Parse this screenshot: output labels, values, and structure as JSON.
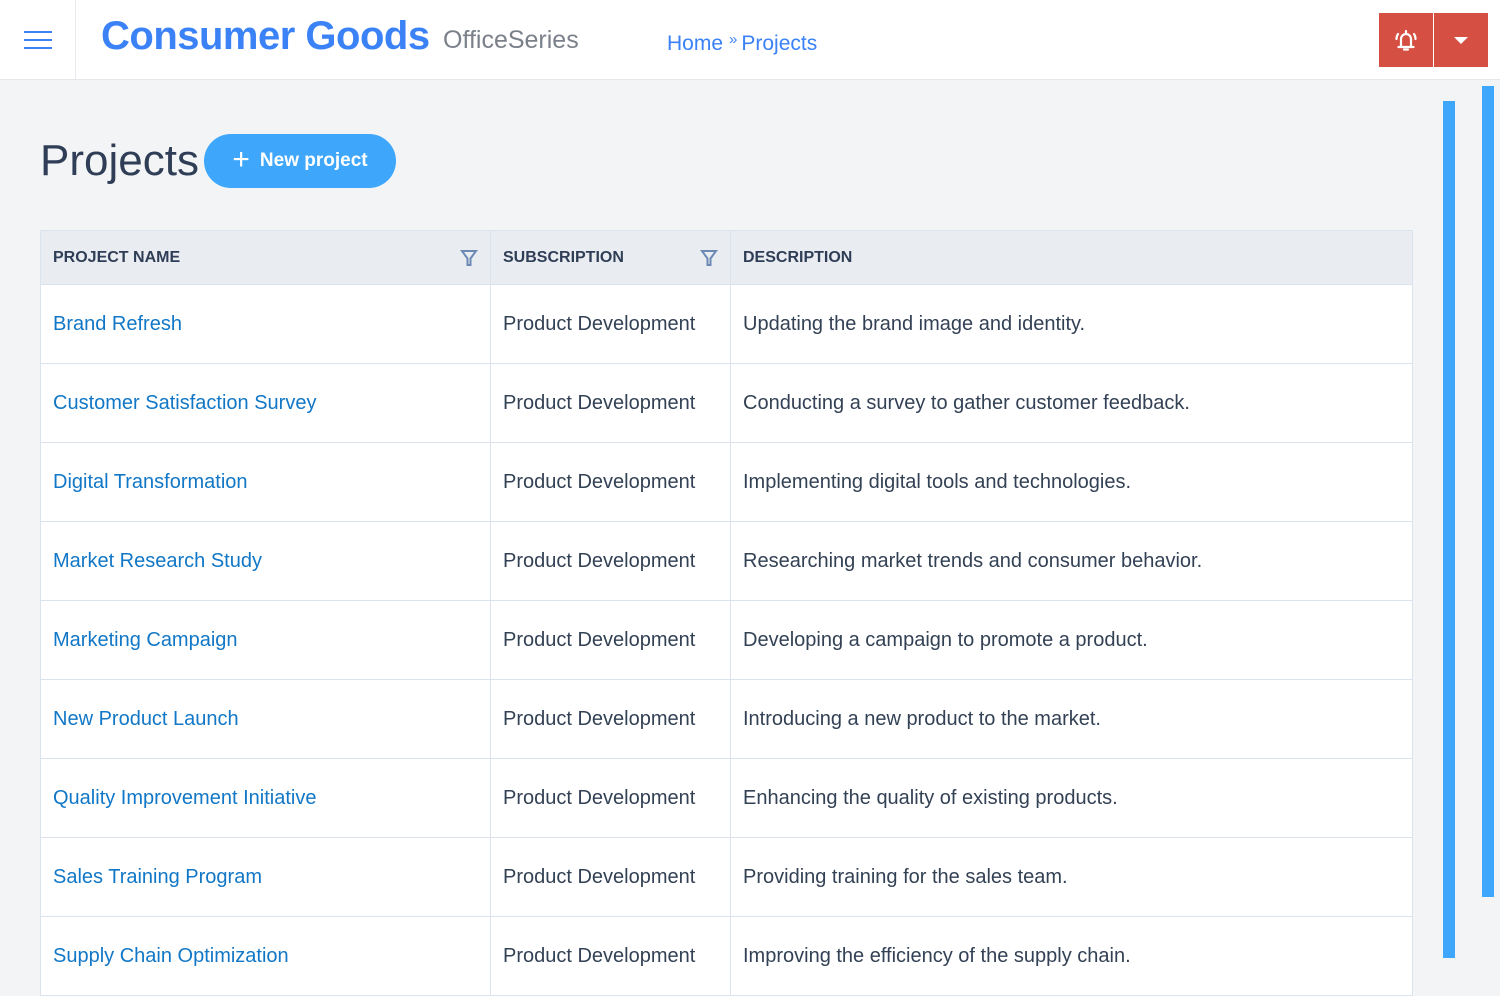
{
  "header": {
    "menu_icon": "hamburger-menu-icon",
    "brand": "Consumer Goods",
    "subbrand": "OfficeSeries",
    "breadcrumb": [
      {
        "label": "Home"
      },
      {
        "separator": "»"
      },
      {
        "label": "Projects"
      }
    ],
    "alarm_icon": "bell-alarm-icon",
    "dropdown_icon": "caret-down-icon",
    "accent_color": "#3b82f6",
    "alert_color": "#d55042"
  },
  "page": {
    "title": "Projects",
    "new_button": {
      "icon": "plus-icon",
      "label": "New project"
    }
  },
  "table": {
    "columns": [
      {
        "label": "PROJECT NAME",
        "filter": true
      },
      {
        "label": "SUBSCRIPTION",
        "filter": true
      },
      {
        "label": "DESCRIPTION",
        "filter": false
      }
    ],
    "rows": [
      {
        "name": "Brand Refresh",
        "subscription": "Product Development",
        "description": "Updating the brand image and identity."
      },
      {
        "name": "Customer Satisfaction Survey",
        "subscription": "Product Development",
        "description": "Conducting a survey to gather customer feedback."
      },
      {
        "name": "Digital Transformation",
        "subscription": "Product Development",
        "description": "Implementing digital tools and technologies."
      },
      {
        "name": "Market Research Study",
        "subscription": "Product Development",
        "description": "Researching market trends and consumer behavior."
      },
      {
        "name": "Marketing Campaign",
        "subscription": "Product Development",
        "description": "Developing a campaign to promote a product."
      },
      {
        "name": "New Product Launch",
        "subscription": "Product Development",
        "description": "Introducing a new product to the market."
      },
      {
        "name": "Quality Improvement Initiative",
        "subscription": "Product Development",
        "description": "Enhancing the quality of existing products."
      },
      {
        "name": "Sales Training Program",
        "subscription": "Product Development",
        "description": "Providing training for the sales team."
      },
      {
        "name": "Supply Chain Optimization",
        "subscription": "Product Development",
        "description": "Improving the efficiency of the supply chain."
      }
    ]
  }
}
